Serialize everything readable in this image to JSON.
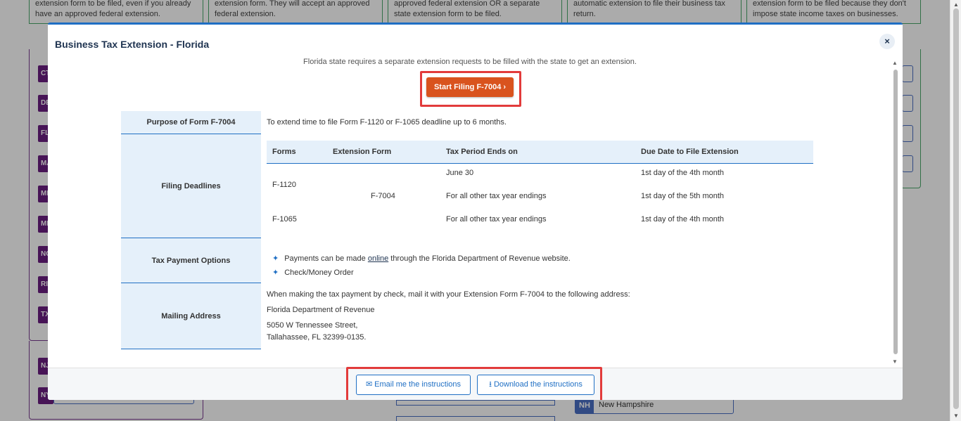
{
  "background": {
    "cards": [
      "extension form to be filed, even if you already have an approved federal extension.",
      "extension form. They will accept an approved federal extension.",
      "approved federal extension OR a separate state extension form to be filed.",
      "automatic extension to file their business tax return.",
      "extension form to be filed because they don't impose state income taxes on businesses."
    ],
    "tags": [
      "CT",
      "DE",
      "FL",
      "MA",
      "MD",
      "MN",
      "NC",
      "RI",
      "TX",
      "NJ",
      "NY"
    ],
    "nh": {
      "abbr": "NH",
      "name": "New Hampshire"
    }
  },
  "modal": {
    "title": "Business Tax Extension - Florida",
    "close_icon": "×",
    "intro": "Florida state requires a separate extension requests to be filled with the state to get an extension.",
    "start_button": "Start Filing F-7004 ›",
    "purpose": {
      "label": "Purpose of Form F-7004",
      "value": "To extend time to file Form F-1120 or F-1065 deadline up to 6 months."
    },
    "deadlines": {
      "label": "Filing Deadlines",
      "headers": [
        "Forms",
        "Extension Form",
        "Tax Period Ends on",
        "Due Date to File Extension"
      ],
      "form_1120": "F-1120",
      "form_1065": "F-1065",
      "extension_form": "F-7004",
      "r1_period": "June 30",
      "r1_due": "1st day of the 4th month",
      "r2_period": "For all other tax year endings",
      "r2_due": "1st day of the 5th month",
      "r3_period": "For all other tax year endings",
      "r3_due": "1st day of the 4th month"
    },
    "payment": {
      "label": "Tax Payment Options",
      "line1_pre": "Payments can be made ",
      "line1_link": "online",
      "line1_post": " through the Florida Department of Revenue website.",
      "line2": "Check/Money Order",
      "bullet_icon": "✦"
    },
    "mailing": {
      "label": "Mailing Address",
      "intro": "When making the tax payment by check, mail it with your Extension Form F-7004 to the following address:",
      "org": "Florida Department of Revenue",
      "street": "5050 W Tennessee Street,",
      "city": "Tallahassee, FL 32399-0135."
    },
    "footer": {
      "email_icon": "✉",
      "email_button": "Email me the instructions",
      "download_icon": "⭳",
      "download_button": "Download the instructions"
    }
  }
}
